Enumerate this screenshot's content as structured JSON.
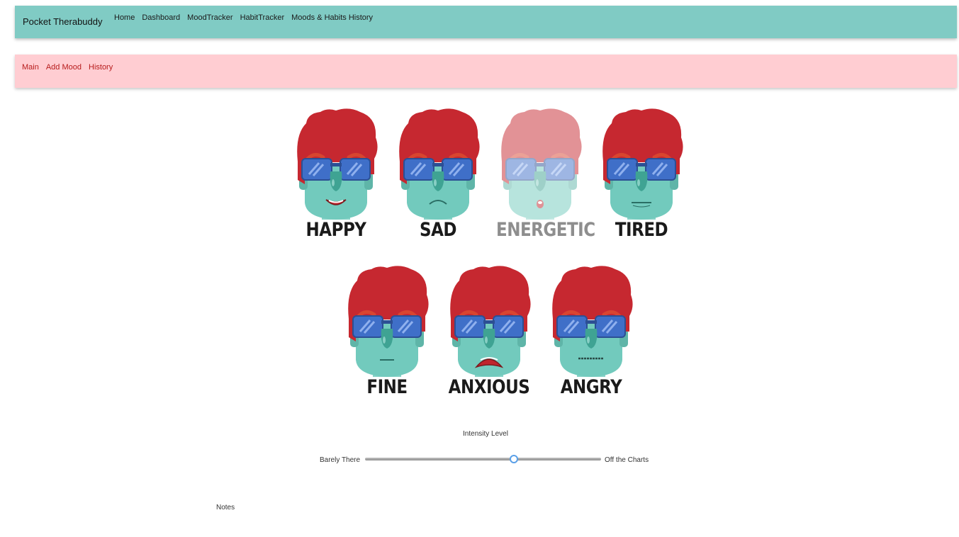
{
  "app": {
    "brand": "Pocket Therabuddy"
  },
  "topnav": {
    "links": [
      "Home",
      "Dashboard",
      "MoodTracker",
      "HabitTracker",
      "Moods & Habits History"
    ]
  },
  "subnav": {
    "links": [
      "Main",
      "Add Mood",
      "History"
    ]
  },
  "moods": [
    {
      "label": "HAPPY",
      "mouth": "happy",
      "selected": true
    },
    {
      "label": "SAD",
      "mouth": "sad",
      "selected": true
    },
    {
      "label": "ENERGETIC",
      "mouth": "energetic",
      "selected": false
    },
    {
      "label": "TIRED",
      "mouth": "tired",
      "selected": true
    },
    {
      "label": "FINE",
      "mouth": "fine",
      "selected": true
    },
    {
      "label": "ANXIOUS",
      "mouth": "anxious",
      "selected": true
    },
    {
      "label": "ANGRY",
      "mouth": "angry",
      "selected": true
    }
  ],
  "intensity": {
    "title": "Intensity Level",
    "min_label": "Barely There",
    "max_label": "Off the Charts",
    "value": 0.63
  },
  "notes": {
    "label": "Notes"
  },
  "colors": {
    "nav_bg": "#80cbc4",
    "subnav_bg": "#ffcdd2",
    "subnav_link": "#b71c1c",
    "hair": "#c62830",
    "skin": "#72cabd",
    "glasses": "#3f6fc8",
    "slider_thumb": "#5aa0e8"
  }
}
